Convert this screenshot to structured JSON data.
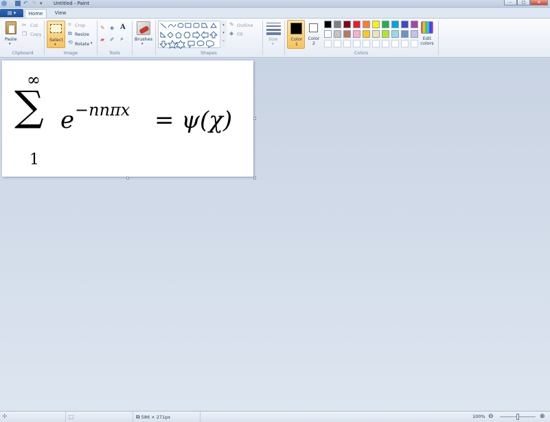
{
  "window": {
    "title": "Untitled - Paint",
    "controls": [
      "–",
      "□",
      "✕"
    ]
  },
  "tabs": {
    "file": "▤ ▾",
    "home": "Home",
    "view": "View"
  },
  "clipboard": {
    "paste": "Paste",
    "cut": "Cut",
    "copy": "Copy",
    "group": "Clipboard"
  },
  "image": {
    "select": "Select",
    "crop": "Crop",
    "resize": "Resize",
    "rotate": "Rotate",
    "group": "Image"
  },
  "tools": {
    "group": "Tools"
  },
  "brushes": {
    "label": "Brushes"
  },
  "shapes": {
    "outline": "Outline",
    "fill": "Fill",
    "group": "Shapes"
  },
  "size": {
    "label": "Size"
  },
  "colors": {
    "color1": "Color 1",
    "color2": "Color 2",
    "edit": "Edit colors",
    "group": "Colors",
    "color1_value": "#000000",
    "color2_value": "#ffffff",
    "palette_row1": [
      "#000000",
      "#7f7f7f",
      "#880015",
      "#ed1c24",
      "#ff7f27",
      "#fff200",
      "#22b14c",
      "#00a2e8",
      "#3f48cc",
      "#a349a4"
    ],
    "palette_row2": [
      "#ffffff",
      "#c3c3c3",
      "#b97a57",
      "#ffaec9",
      "#ffc90e",
      "#efe4b0",
      "#b5e61d",
      "#99d9ea",
      "#7092be",
      "#c8bfe7"
    ],
    "palette_row3": [
      "#ffffff",
      "#ffffff",
      "#ffffff",
      "#ffffff",
      "#ffffff",
      "#ffffff",
      "#ffffff",
      "#ffffff",
      "#ffffff",
      "#ffffff"
    ]
  },
  "canvas_content": {
    "sum_top": "∞",
    "sum_sign": "∑",
    "sum_bottom": "1",
    "base": "e",
    "exponent": "−nnπx",
    "rhs": "= ψ(χ)"
  },
  "status": {
    "dimensions": "586 × 271px",
    "zoom": "100%",
    "zoom_out": "⊖",
    "zoom_in": "⊕"
  }
}
